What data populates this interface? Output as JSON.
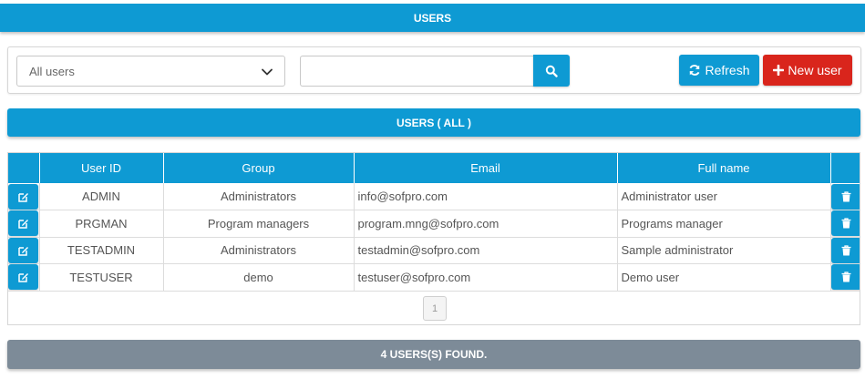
{
  "header": {
    "title": "USERS"
  },
  "toolbar": {
    "group_select": {
      "selected": "All users",
      "icon": "chevron-down-icon"
    },
    "search": {
      "value": "",
      "placeholder": "",
      "icon": "search-icon"
    },
    "refresh_label": "Refresh",
    "refresh_icon": "refresh-icon",
    "new_user_label": "New user",
    "new_user_icon": "plus-icon"
  },
  "section": {
    "title": "USERS ( ALL )"
  },
  "table": {
    "columns": [
      "User ID",
      "Group",
      "Email",
      "Full name"
    ],
    "rows": [
      {
        "user_id": "ADMIN",
        "group": "Administrators",
        "email": "info@sofpro.com",
        "full_name": "Administrator user"
      },
      {
        "user_id": "PRGMAN",
        "group": "Program managers",
        "email": "program.mng@sofpro.com",
        "full_name": "Programs manager"
      },
      {
        "user_id": "TESTADMIN",
        "group": "Administrators",
        "email": "testadmin@sofpro.com",
        "full_name": "Sample administrator"
      },
      {
        "user_id": "TESTUSER",
        "group": "demo",
        "email": "testuser@sofpro.com",
        "full_name": "Demo user"
      }
    ],
    "row_actions": {
      "edit_icon": "edit-icon",
      "delete_icon": "trash-icon"
    }
  },
  "pagination": {
    "current_page": "1"
  },
  "footer": {
    "status": "4 USERS(S) FOUND."
  },
  "colors": {
    "primary": "#0e9ad3",
    "danger": "#d9251c",
    "footer": "#7d8b98"
  }
}
